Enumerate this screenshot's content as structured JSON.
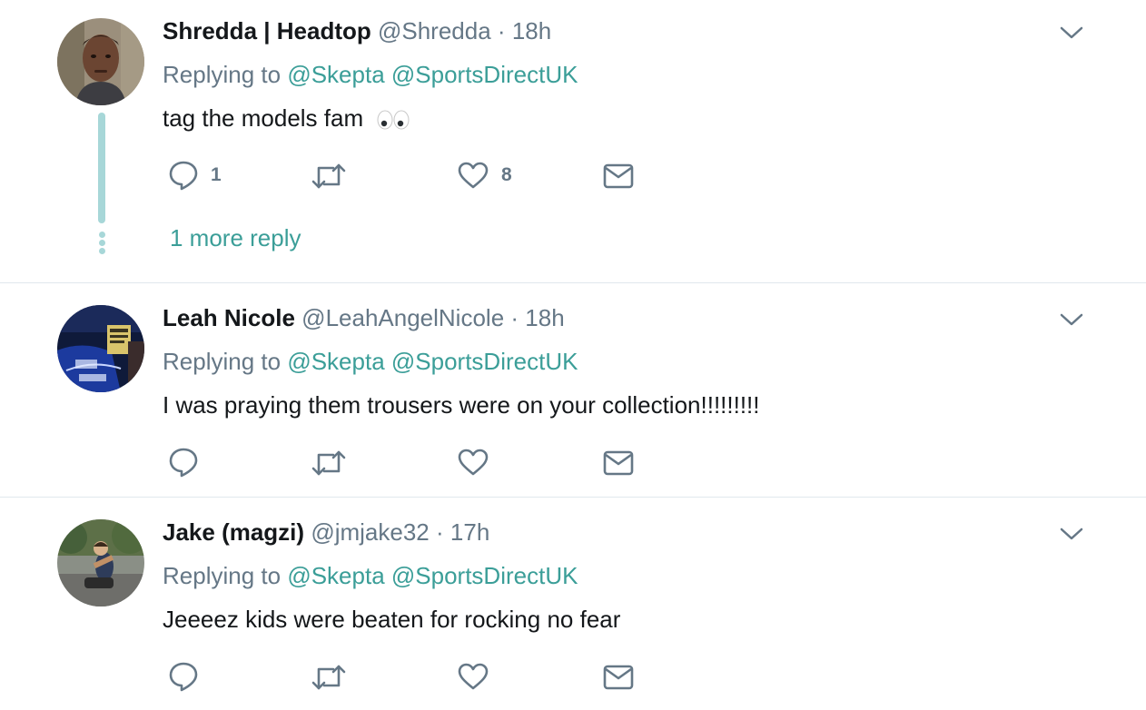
{
  "tweets": [
    {
      "name": "Shredda | Headtop",
      "handle": "@Shredda",
      "time": "18h",
      "replying_label": "Replying to",
      "mentions": [
        "@Skepta",
        "@SportsDirectUK"
      ],
      "text": "tag the models fam",
      "emoji": "eyes",
      "reply_count": "1",
      "retweet_count": "",
      "like_count": "8",
      "more_replies": "1 more reply"
    },
    {
      "name": "Leah Nicole",
      "handle": "@LeahAngelNicole",
      "time": "18h",
      "replying_label": "Replying to",
      "mentions": [
        "@Skepta",
        "@SportsDirectUK"
      ],
      "text": "I was praying them trousers were on your collection!!!!!!!!!",
      "reply_count": "",
      "retweet_count": "",
      "like_count": ""
    },
    {
      "name": "Jake (magzi)",
      "handle": "@jmjake32",
      "time": "17h",
      "replying_label": "Replying to",
      "mentions": [
        "@Skepta",
        "@SportsDirectUK"
      ],
      "text": "Jeeeez kids were beaten for rocking no fear",
      "reply_count": "",
      "retweet_count": "",
      "like_count": ""
    }
  ],
  "separator": "·",
  "colors": {
    "accent": "#3b9e98",
    "thread_line": "#a7d7d8",
    "meta": "#657786",
    "icon": "#657786",
    "divider": "#e1e8ed"
  },
  "icons": [
    "reply-icon",
    "retweet-icon",
    "like-icon",
    "direct-message-icon",
    "chevron-down-icon"
  ]
}
